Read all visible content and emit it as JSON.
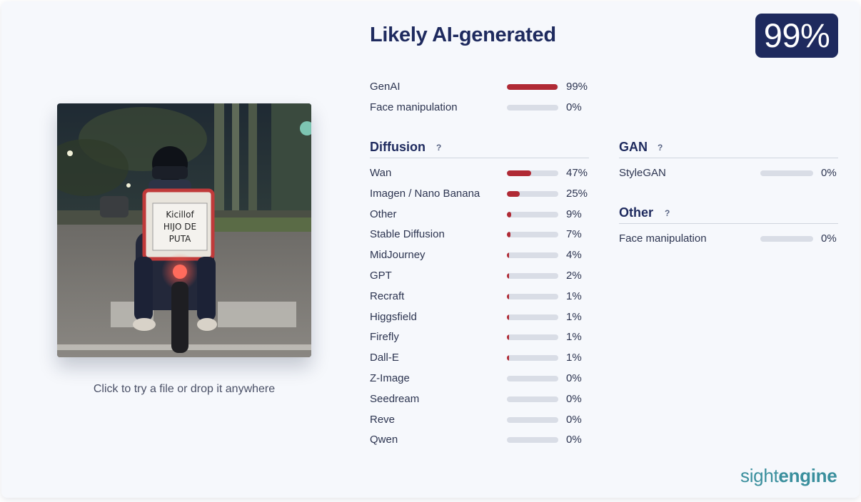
{
  "verdict": "Likely AI-generated",
  "score": "99%",
  "drop_hint": "Click to try a file or drop it anywhere",
  "photo_sign": {
    "line1": "Kicillof",
    "line2": "HIJO DE",
    "line3": "PUTA"
  },
  "summary": [
    {
      "label": "GenAI",
      "value": 99,
      "pct": "99%"
    },
    {
      "label": "Face manipulation",
      "value": 0,
      "pct": "0%"
    }
  ],
  "diffusion": {
    "title": "Diffusion",
    "help": "?",
    "items": [
      {
        "label": "Wan",
        "value": 47,
        "pct": "47%"
      },
      {
        "label": "Imagen / Nano Banana",
        "value": 25,
        "pct": "25%"
      },
      {
        "label": "Other",
        "value": 9,
        "pct": "9%"
      },
      {
        "label": "Stable Diffusion",
        "value": 7,
        "pct": "7%"
      },
      {
        "label": "MidJourney",
        "value": 4,
        "pct": "4%"
      },
      {
        "label": "GPT",
        "value": 2,
        "pct": "2%"
      },
      {
        "label": "Recraft",
        "value": 1,
        "pct": "1%"
      },
      {
        "label": "Higgsfield",
        "value": 1,
        "pct": "1%"
      },
      {
        "label": "Firefly",
        "value": 1,
        "pct": "1%"
      },
      {
        "label": "Dall-E",
        "value": 1,
        "pct": "1%"
      },
      {
        "label": "Z-Image",
        "value": 0,
        "pct": "0%"
      },
      {
        "label": "Seedream",
        "value": 0,
        "pct": "0%"
      },
      {
        "label": "Reve",
        "value": 0,
        "pct": "0%"
      },
      {
        "label": "Qwen",
        "value": 0,
        "pct": "0%"
      }
    ]
  },
  "gan": {
    "title": "GAN",
    "help": "?",
    "items": [
      {
        "label": "StyleGAN",
        "value": 0,
        "pct": "0%"
      }
    ]
  },
  "other": {
    "title": "Other",
    "help": "?",
    "items": [
      {
        "label": "Face manipulation",
        "value": 0,
        "pct": "0%"
      }
    ]
  },
  "brand": {
    "part1": "sight",
    "part2": "engine"
  },
  "colors": {
    "accent": "#1e2a5e",
    "bar_fill": "#b02a35",
    "bar_track": "#d9dde6",
    "brand": "#3a8f9d"
  }
}
